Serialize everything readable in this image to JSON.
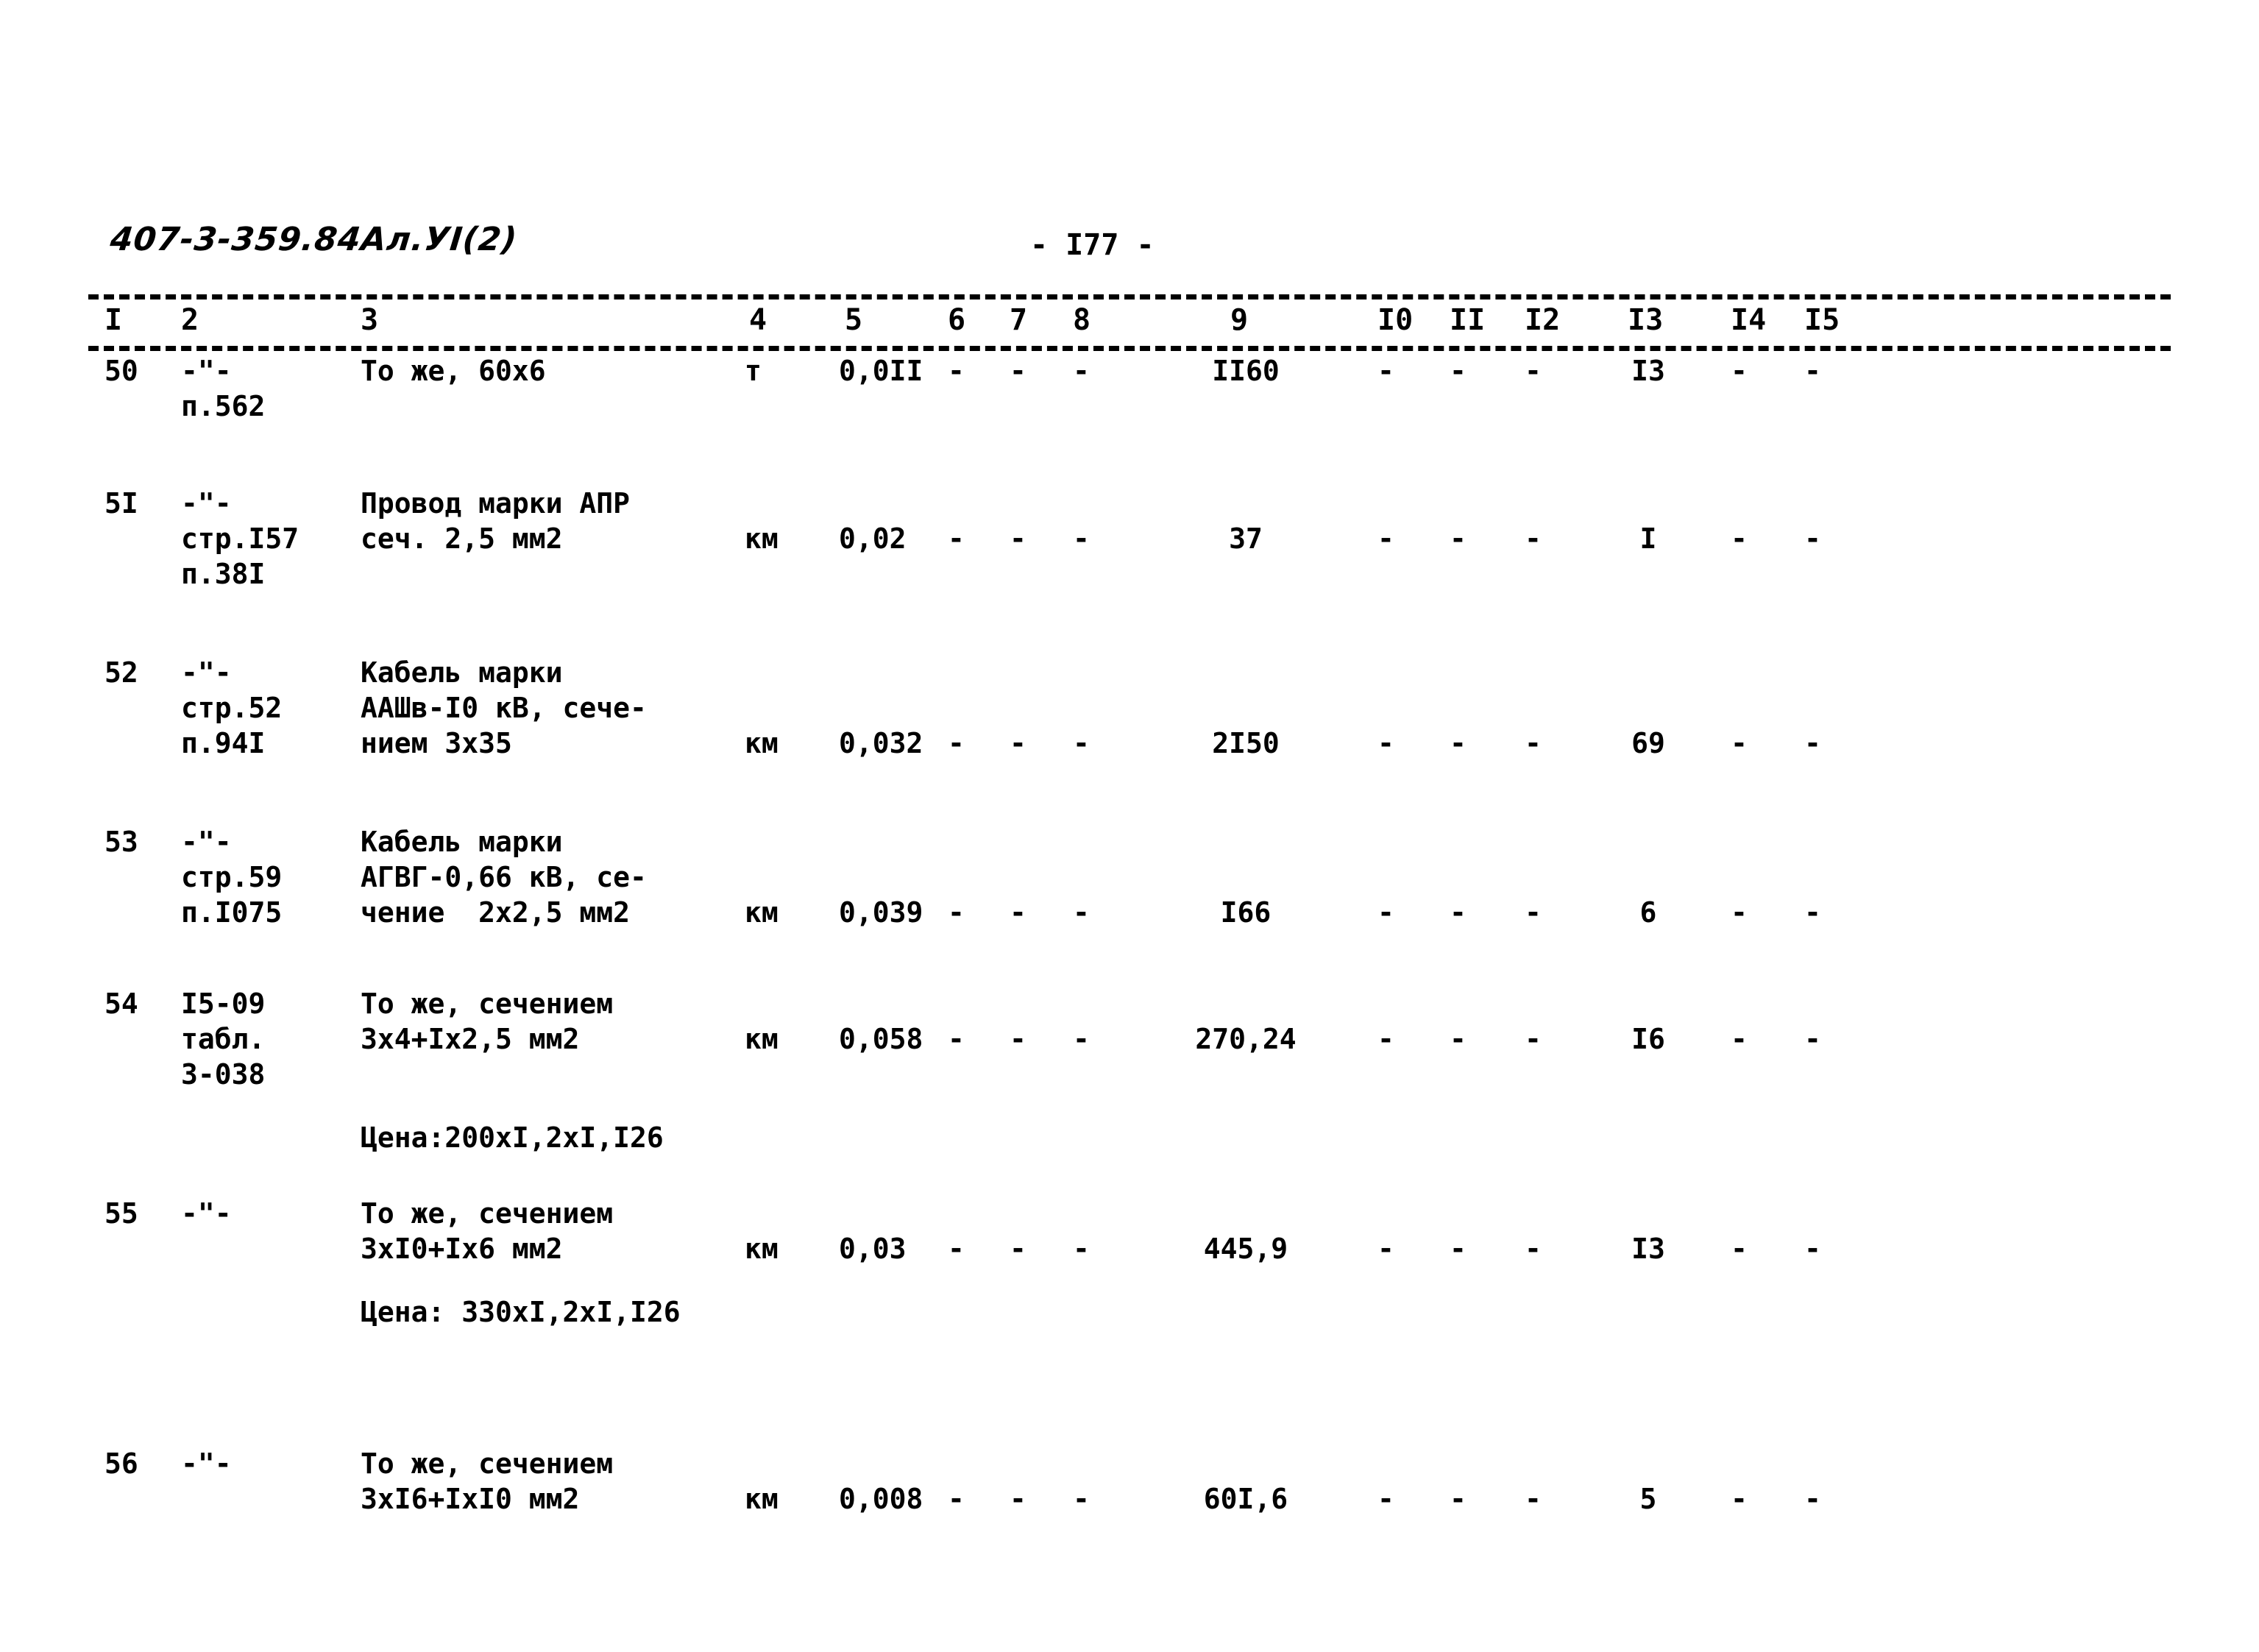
{
  "document": {
    "code": "407-3-359.84Ал.УI(2)",
    "page_label": "- I77 -"
  },
  "table": {
    "column_headers": [
      "I",
      "2",
      "3",
      "4",
      "5",
      "6",
      "7",
      "8",
      "9",
      "I0",
      "II",
      "I2",
      "I3",
      "I4",
      "I5"
    ],
    "dash_symbol": "-",
    "rows": [
      {
        "num": "50",
        "justification": [
          "-\"-",
          "п.562"
        ],
        "name": [
          "То же, 60х6"
        ],
        "unit": "т",
        "qty": "0,0II",
        "c6": "-",
        "c7": "-",
        "c8": "-",
        "c9": "II60",
        "c10": "-",
        "c11": "-",
        "c12": "-",
        "c13": "I3",
        "c14": "-",
        "c15": "-",
        "note": ""
      },
      {
        "num": "5I",
        "justification": [
          "-\"-",
          "стр.I57",
          "п.38I"
        ],
        "name": [
          "Провод марки АПР",
          "сеч. 2,5 мм2"
        ],
        "unit": "км",
        "qty": "0,02",
        "c6": "-",
        "c7": "-",
        "c8": "-",
        "c9": "37",
        "c10": "-",
        "c11": "-",
        "c12": "-",
        "c13": "I",
        "c14": "-",
        "c15": "-",
        "note": ""
      },
      {
        "num": "52",
        "justification": [
          "-\"-",
          "стр.52",
          "п.94I"
        ],
        "name": [
          "Кабель марки",
          "ААШв-I0 кВ, сече-",
          "нием 3х35"
        ],
        "unit": "км",
        "qty": "0,032",
        "c6": "-",
        "c7": "-",
        "c8": "-",
        "c9": "2I50",
        "c10": "-",
        "c11": "-",
        "c12": "-",
        "c13": "69",
        "c14": "-",
        "c15": "-",
        "note": ""
      },
      {
        "num": "53",
        "justification": [
          "-\"-",
          "стр.59",
          "п.I075"
        ],
        "name": [
          "Кабель марки",
          "АГВГ-0,66 кВ, се-",
          "чение  2х2,5 мм2"
        ],
        "unit": "км",
        "qty": "0,039",
        "c6": "-",
        "c7": "-",
        "c8": "-",
        "c9": "I66",
        "c10": "-",
        "c11": "-",
        "c12": "-",
        "c13": "6",
        "c14": "-",
        "c15": "-",
        "note": ""
      },
      {
        "num": "54",
        "justification": [
          "I5-09",
          "табл.",
          "3-038"
        ],
        "name": [
          "То же, сечением",
          "3х4+Iх2,5 мм2"
        ],
        "unit": "км",
        "qty": "0,058",
        "c6": "-",
        "c7": "-",
        "c8": "-",
        "c9": "270,24",
        "c10": "-",
        "c11": "-",
        "c12": "-",
        "c13": "I6",
        "c14": "-",
        "c15": "-",
        "note": "Цена:200хI,2хI,I26"
      },
      {
        "num": "55",
        "justification": [
          "-\"-"
        ],
        "name": [
          "То же, сечением",
          "3хI0+Iх6 мм2"
        ],
        "unit": "км",
        "qty": "0,03",
        "c6": "-",
        "c7": "-",
        "c8": "-",
        "c9": "445,9",
        "c10": "-",
        "c11": "-",
        "c12": "-",
        "c13": "I3",
        "c14": "-",
        "c15": "-",
        "note": "Цена: 330хI,2хI,I26"
      },
      {
        "num": "56",
        "justification": [
          "-\"-"
        ],
        "name": [
          "То же, сечением",
          "3хI6+IхI0 мм2"
        ],
        "unit": "км",
        "qty": "0,008",
        "c6": "-",
        "c7": "-",
        "c8": "-",
        "c9": "60I,6",
        "c10": "-",
        "c11": "-",
        "c12": "-",
        "c13": "5",
        "c14": "-",
        "c15": "-",
        "note": ""
      }
    ]
  }
}
